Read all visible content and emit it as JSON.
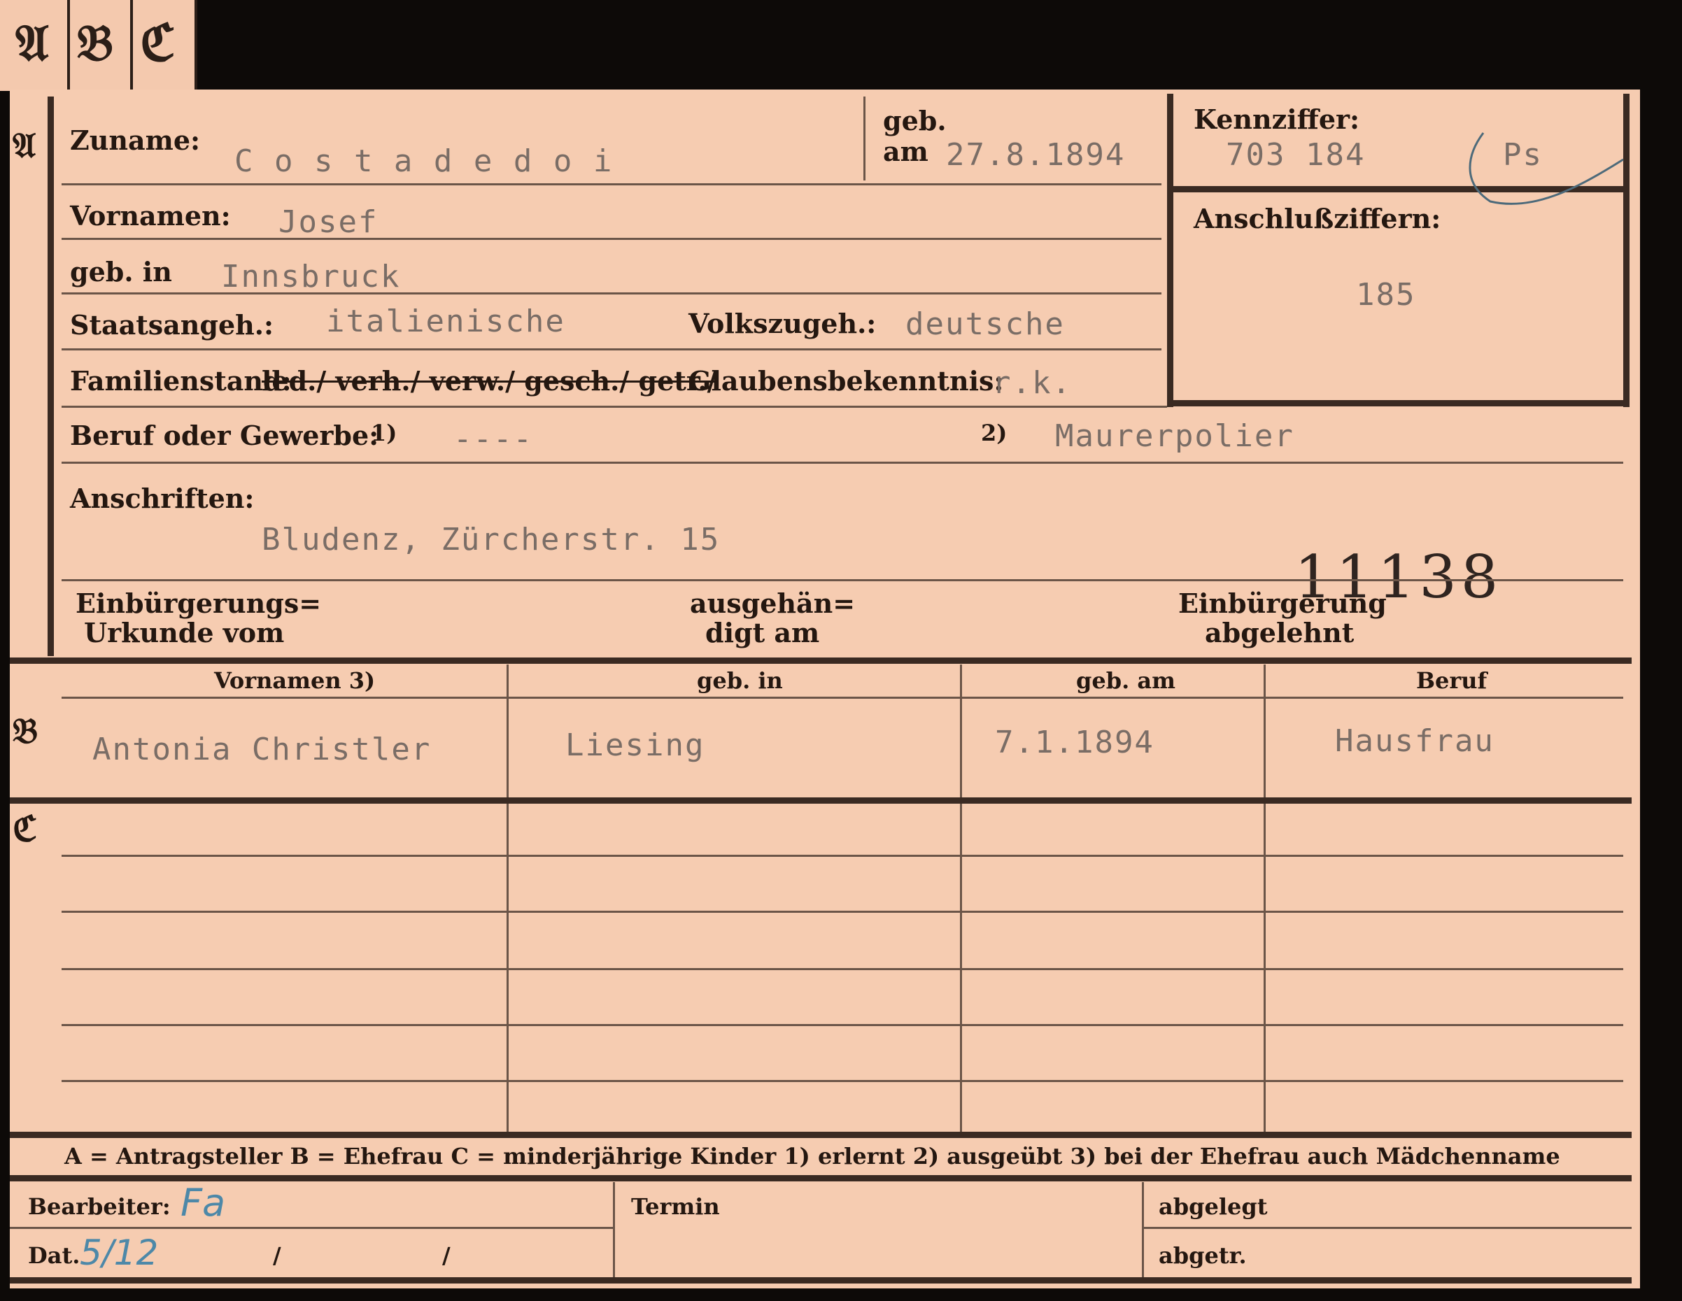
{
  "tabs": [
    "𝔄",
    "𝔅",
    "ℭ"
  ],
  "section_a": {
    "letter": "𝔄",
    "surname_label": "Zuname:",
    "surname_value": "C o s t a d e d o i",
    "geb_label": "geb.",
    "am_label": "am",
    "birthdate_value": "27.8.1894",
    "kennziffer_label": "Kennziffer:",
    "kennziffer_value": "703 184",
    "kennziffer_suffix": "Ps",
    "anschluss_label": "Anschlußziffern:",
    "anschluss_value": "185",
    "vornamen_label": "Vornamen:",
    "vornamen_value": "Josef",
    "gebin_label": "geb. in",
    "gebin_value": "Innsbruck",
    "staats_label": "Staatsangeh.:",
    "staats_value": "italienische",
    "volks_label": "Volkszugeh.:",
    "volks_value": "deutsche",
    "familien_label": "Familienstand:",
    "familien_options": "led./ verh./ verw./ gesch./ getr./",
    "glaubens_label": "Glaubensbekenntnis:",
    "glaubens_value": "r.k.",
    "beruf_label": "Beruf oder Gewerbe:",
    "beruf_note1": "1)",
    "beruf_value1": "----",
    "beruf_note2": "2)",
    "beruf_value2": "Maurerpolier",
    "anschriften_label": "Anschriften:",
    "anschriften_value": "Bludenz, Zürcherstr. 15",
    "stamp_number": "11138",
    "einb_label_1": "Einbürgerungs=",
    "einb_label_2": "Urkunde vom",
    "ausgeh_label_1": "ausgehän=",
    "ausgeh_label_2": "digt am",
    "abgelehnt_label_1": "Einbürgerung",
    "abgelehnt_label_2": "abgelehnt"
  },
  "section_b": {
    "letter": "𝔅",
    "headers": [
      "Vornamen 3)",
      "geb. in",
      "geb. am",
      "Beruf"
    ],
    "row": [
      "Antonia Christler",
      "Liesing",
      "7.1.1894",
      "Hausfrau"
    ]
  },
  "section_c": {
    "letter": "ℭ"
  },
  "legend": "A = Antragsteller   B = Ehefrau   C = minderjährige Kinder   1) erlernt   2) ausgeübt   3) bei der Ehefrau auch Mädchenname",
  "footer": {
    "bearbeiter_label": "Bearbeiter:",
    "bearbeiter_value": "Fa",
    "dat_label": "Dat.",
    "dat_value": "5/12",
    "slash1": "/",
    "slash2": "/",
    "termin_label": "Termin",
    "abgelegt_label": "abgelegt",
    "abgetr_label": "abgetr."
  }
}
